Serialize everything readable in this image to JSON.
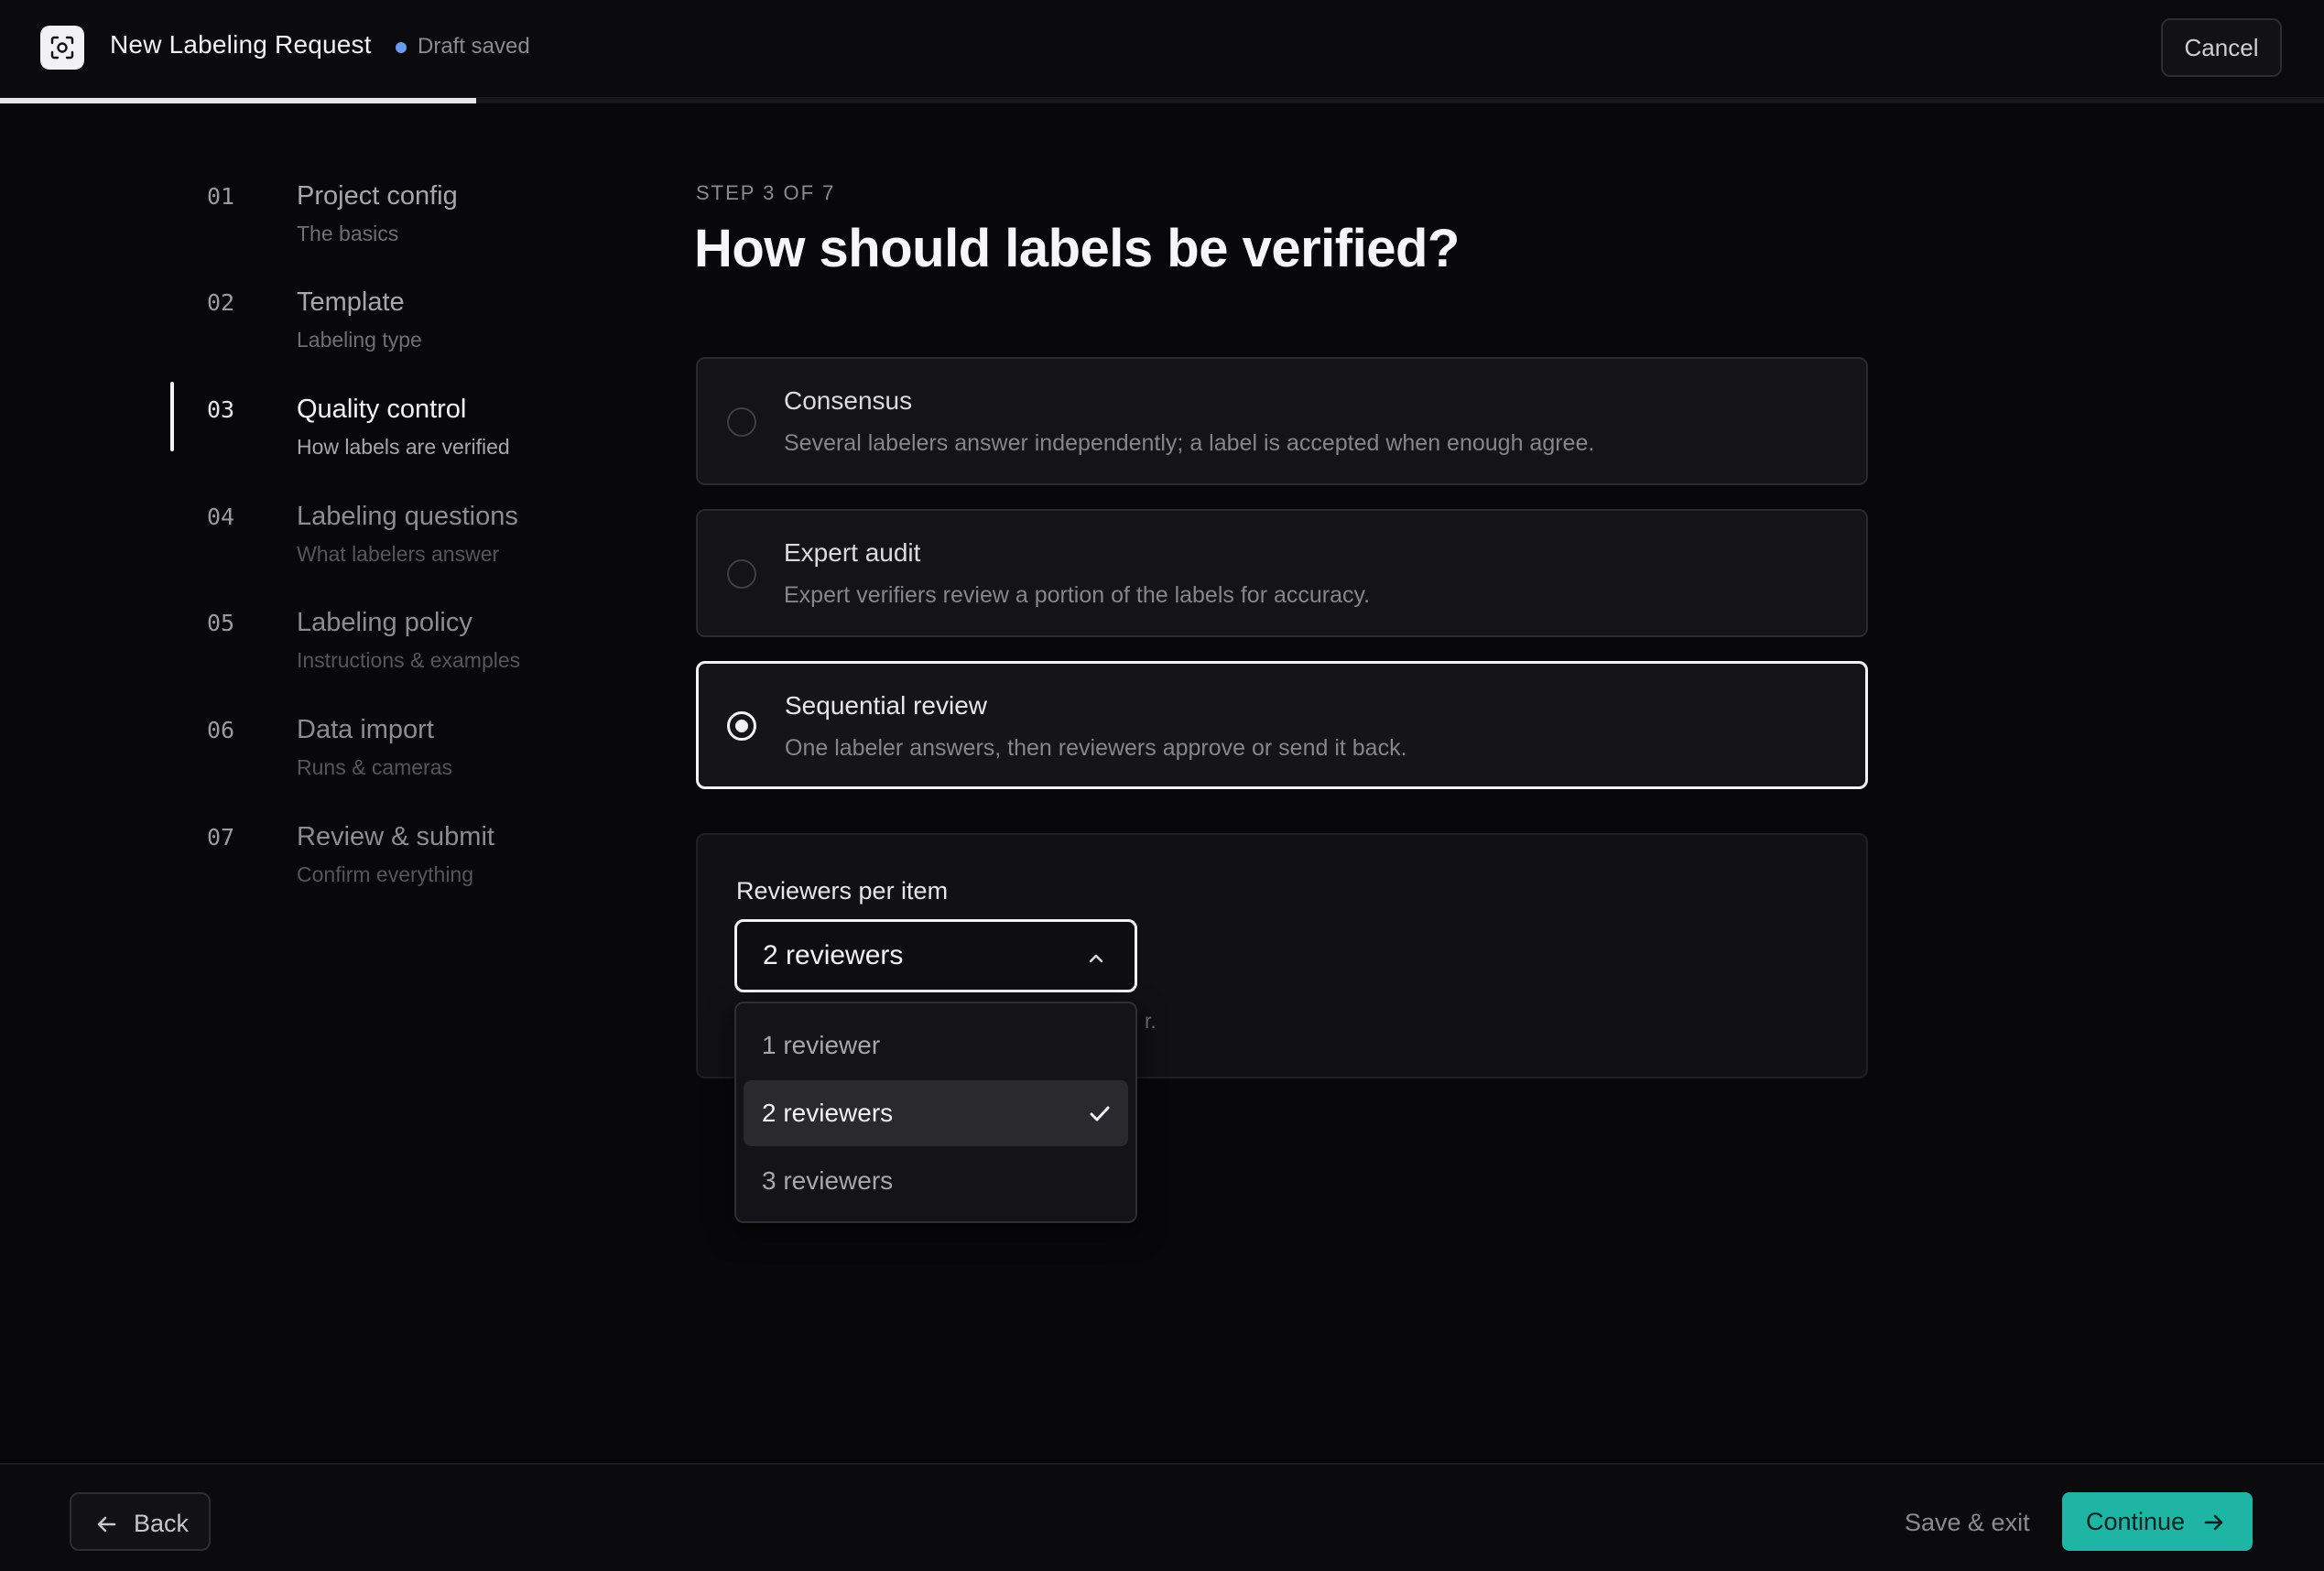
{
  "header": {
    "title": "New Labeling Request",
    "draft_status": "Draft saved",
    "cancel_label": "Cancel",
    "progress_fraction": 0.205
  },
  "steps": [
    {
      "number": "01",
      "title": "Project config",
      "subtitle": "The basics",
      "state": "done"
    },
    {
      "number": "02",
      "title": "Template",
      "subtitle": "Labeling type",
      "state": "done"
    },
    {
      "number": "03",
      "title": "Quality control",
      "subtitle": "How labels are verified",
      "state": "active"
    },
    {
      "number": "04",
      "title": "Labeling questions",
      "subtitle": "What labelers answer",
      "state": "future"
    },
    {
      "number": "05",
      "title": "Labeling policy",
      "subtitle": "Instructions & examples",
      "state": "future"
    },
    {
      "number": "06",
      "title": "Data import",
      "subtitle": "Runs & cameras",
      "state": "future"
    },
    {
      "number": "07",
      "title": "Review & submit",
      "subtitle": "Confirm everything",
      "state": "future"
    }
  ],
  "main": {
    "eyebrow": "STEP 3 OF 7",
    "title": "How should labels be verified?",
    "options": [
      {
        "title": "Consensus",
        "description": "Several labelers answer independently; a label is accepted when enough agree.",
        "selected": false
      },
      {
        "title": "Expert audit",
        "description": "Expert verifiers review a portion of the labels for accuracy.",
        "selected": false
      },
      {
        "title": "Sequential review",
        "description": "One labeler answers, then reviewers approve or send it back.",
        "selected": true
      }
    ],
    "reviewers": {
      "label": "Reviewers per item",
      "selected_value": "2 reviewers",
      "hint_visible_fragment": "r.",
      "options": [
        "1 reviewer",
        "2 reviewers",
        "3 reviewers"
      ],
      "selected_index": 1
    }
  },
  "footer": {
    "back_label": "Back",
    "save_exit_label": "Save & exit",
    "continue_label": "Continue"
  },
  "colors": {
    "accent": "#1fb5a5",
    "draft_dot": "#6b9bf0",
    "background": "#08080a"
  }
}
